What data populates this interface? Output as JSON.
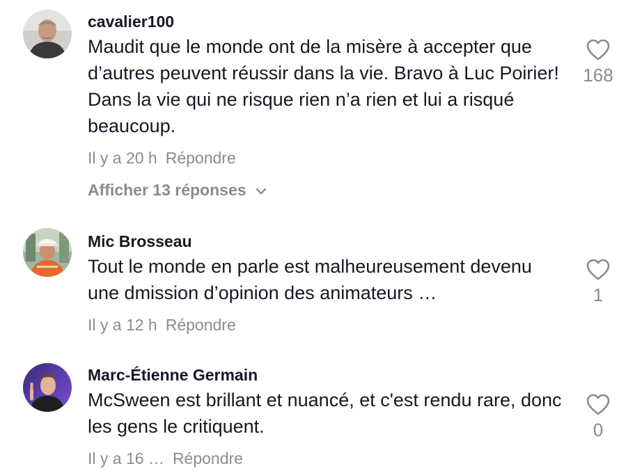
{
  "comments": [
    {
      "username": "cavalier100",
      "text": "Maudit que le monde ont de la misère à accepter que d’autres peuvent réussir dans la vie. Bravo à Luc Poirier! Dans la vie qui ne risque rien n’a rien et lui a risqué beaucoup.",
      "time": "Il y a 20 h",
      "reply_label": "Répondre",
      "replies_label": "Afficher 13 réponses",
      "likes": "168"
    },
    {
      "username": "Mic Brosseau",
      "text": "Tout le monde en parle est malheureusement devenu une dmission d’opinion des animateurs …",
      "time": "Il y a 12 h",
      "reply_label": "Répondre",
      "likes": "1"
    },
    {
      "username": "Marc-Étienne Germain",
      "text": "McSween est brillant et nuancé, et c'est rendu rare, donc les gens le critiquent.",
      "time": "Il y a 16 …",
      "reply_label": "Répondre",
      "likes": "0"
    }
  ],
  "icons": {
    "like": "heart-outline-icon",
    "expand": "chevron-down-icon"
  },
  "colors": {
    "text": "#161823",
    "muted": "#8a8b91",
    "background": "#ffffff"
  }
}
